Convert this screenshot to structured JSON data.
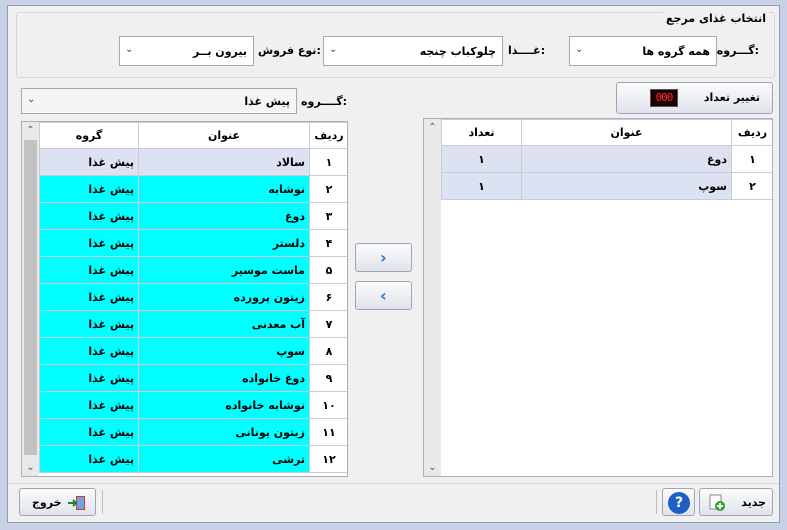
{
  "section": {
    "title": "انتخاب غذای مرجع"
  },
  "filters": {
    "group_label": "گـــروه:",
    "group_value": "همه گروه ها",
    "food_label": "غــــذا:",
    "food_value": "چلوکباب چنجه",
    "sale_type_label": "نوع فروش:",
    "sale_type_value": "بیرون بــر"
  },
  "change_count": {
    "label": "تغییر تعداد",
    "display": "000"
  },
  "left_group": {
    "label": "گــــروه:",
    "value": "پیش غذا"
  },
  "right_table": {
    "headers": {
      "row": "ردیف",
      "title": "عنوان",
      "count": "تعداد"
    },
    "rows": [
      {
        "num": "۱",
        "title": "دوغ",
        "count": "۱"
      },
      {
        "num": "۲",
        "title": "سوپ",
        "count": "۱"
      }
    ]
  },
  "left_table": {
    "headers": {
      "row": "ردیف",
      "title": "عنوان",
      "group": "گروه"
    },
    "rows": [
      {
        "num": "۱",
        "title": "سالاد",
        "group": "پیش غذا"
      },
      {
        "num": "۲",
        "title": "نوشابه",
        "group": "پیش غذا"
      },
      {
        "num": "۳",
        "title": "دوغ",
        "group": "پیش غذا"
      },
      {
        "num": "۴",
        "title": "دلستر",
        "group": "پیش غذا"
      },
      {
        "num": "۵",
        "title": "ماست موسیر",
        "group": "پیش غذا"
      },
      {
        "num": "۶",
        "title": "زیتون پرورده",
        "group": "پیش غذا"
      },
      {
        "num": "۷",
        "title": "آب معدنی",
        "group": "پیش غذا"
      },
      {
        "num": "۸",
        "title": "سوپ",
        "group": "پیش غذا"
      },
      {
        "num": "۹",
        "title": "دوغ خانواده",
        "group": "پیش غذا"
      },
      {
        "num": "۱۰",
        "title": "نوشابه خانواده",
        "group": "پیش غذا"
      },
      {
        "num": "۱۱",
        "title": "زیتون یونانی",
        "group": "پیش غذا"
      },
      {
        "num": "۱۲",
        "title": "ترشی",
        "group": "پیش غذا"
      }
    ]
  },
  "buttons": {
    "new": "جدید",
    "exit": "خروج"
  },
  "colors": {
    "selected_row": "#dde2f2",
    "highlight_row": "#00ffff",
    "accent": "#1f6fd0"
  }
}
